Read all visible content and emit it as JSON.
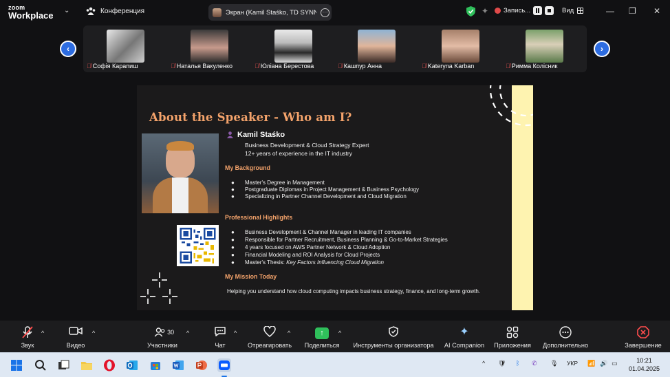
{
  "app": {
    "logo_line1": "zoom",
    "logo_line2": "Workplace",
    "meeting_label": "Конференция"
  },
  "screen_share": {
    "label": "Экран (Kamil Staśko, TD SYNNEX"
  },
  "recording": {
    "label": "Запись..."
  },
  "view": {
    "label": "Вид"
  },
  "participants_strip": [
    {
      "name": "Софія Карапиш"
    },
    {
      "name": "Наталья Вакуленко"
    },
    {
      "name": "Юліана Берестова"
    },
    {
      "name": "Кашпур Анна"
    },
    {
      "name": "Kateryna Karban"
    },
    {
      "name": "Римма Колісник"
    }
  ],
  "slide": {
    "title": "About the Speaker - Who am I?",
    "speaker_name": "Kamil Staśko",
    "speaker_role": "Business Development & Cloud Strategy Expert",
    "speaker_experience": "12+ years of experience in the IT industry",
    "background_heading": "My Background",
    "background_items": [
      "Master's Degree in Management",
      "Postgraduate Diplomas in Project Management & Business Psychology",
      "Specializing in Partner Channel Development and Cloud Migration"
    ],
    "highlights_heading": "Professional Highlights",
    "highlights_items": [
      "Business Development & Channel Manager in leading IT companies",
      "Responsible for Partner Recruitment, Business Planning & Go-to-Market Strategies",
      "4 years focused on AWS Partner Network & Cloud Adoption",
      "Financial Modeling and ROI Analysis for Cloud Projects"
    ],
    "thesis_prefix": "Master's Thesis: ",
    "thesis_title": "Key Factors Influencing Cloud Migration",
    "mission_heading": "My Mission Today",
    "mission_text": "Helping you understand how cloud computing impacts business strategy, finance, and long-term growth.",
    "colors": {
      "accent": "#f4a36b",
      "stripe": "#fef3b0",
      "background": "#1b1a1b"
    }
  },
  "toolbar": {
    "audio": "Звук",
    "video": "Видео",
    "participants": "Участники",
    "participants_count": "30",
    "chat": "Чат",
    "react": "Отреагировать",
    "share": "Поделиться",
    "host_tools": "Инструменты организатора",
    "ai_companion": "AI Companion",
    "apps": "Приложения",
    "more": "Дополнительно",
    "end": "Завершение"
  },
  "taskbar": {
    "language": "УКР",
    "time": "10:21",
    "date": "01.04.2025"
  }
}
